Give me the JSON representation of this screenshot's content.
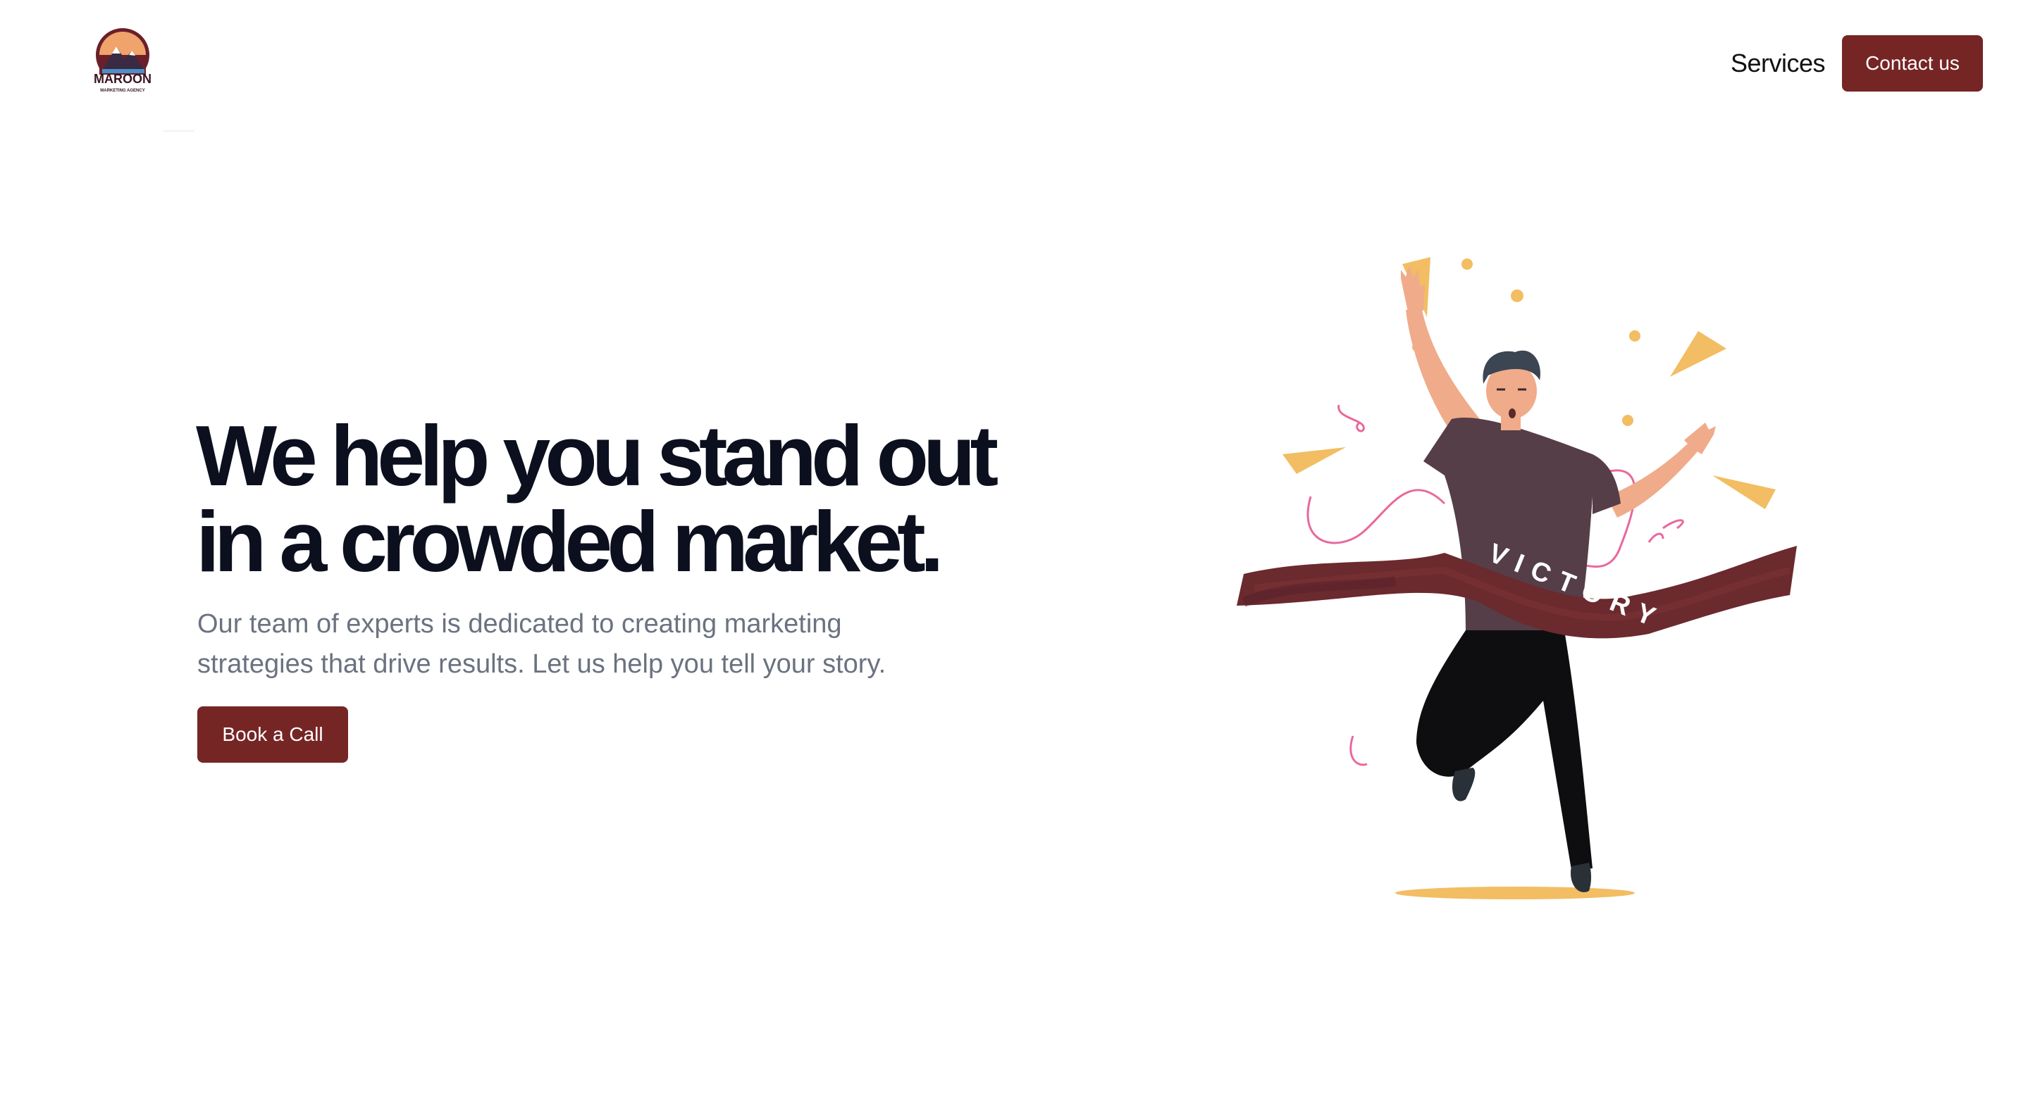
{
  "header": {
    "logo": {
      "brand_text": "MAROON",
      "tagline_text": "MARKETING AGENCY"
    },
    "nav": {
      "services_label": "Services",
      "contact_label": "Contact us"
    }
  },
  "hero": {
    "title_line1": "We help you stand out",
    "title_line2": "in a crowded market.",
    "subtitle_line1": "Our team of experts is dedicated to creating marketing",
    "subtitle_line2": "strategies that drive results. Let us help you tell your story.",
    "cta_label": "Book a Call"
  },
  "illustration": {
    "ribbon_text": "VICTORY"
  },
  "colors": {
    "brand_maroon": "#762525",
    "heading": "#0b0f1e",
    "body_text": "#6b7280",
    "accent_yellow": "#f2bd63",
    "accent_pink": "#e9689c"
  }
}
